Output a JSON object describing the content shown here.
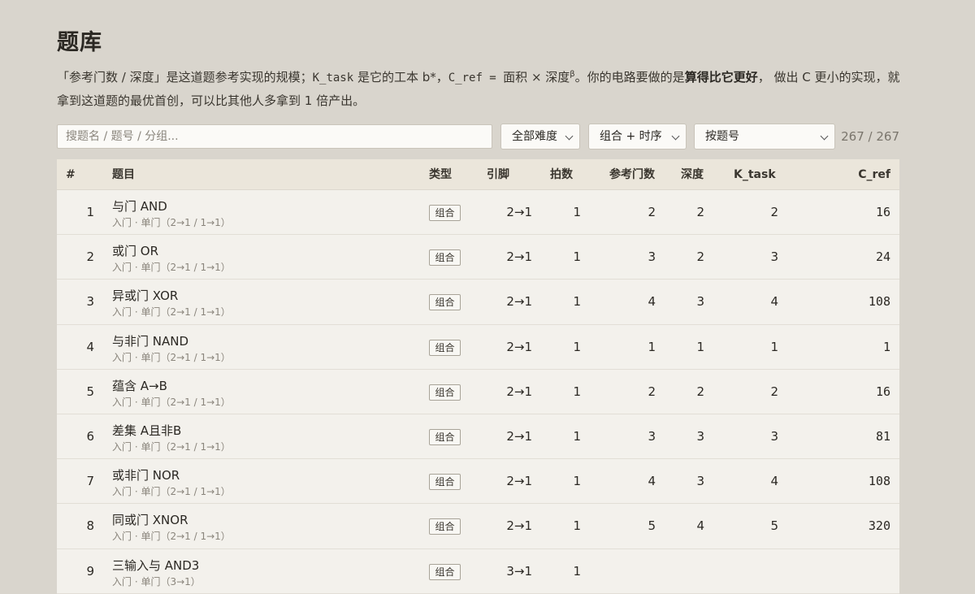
{
  "page": {
    "title": "题库",
    "intro": {
      "p1": "「参考门数 / 深度」是这道题参考实现的规模；",
      "ktask": "K_task",
      "p2": " 是它的工本 b*，",
      "cref": "C_ref = ",
      "p3": "面积 × 深度",
      "beta": "β",
      "p4": "。你的电路要做的是",
      "bold": "算得比它更好",
      "p5": "， 做出 C 更小的实现，就拿到这道题的最优首创，可以比其他人多拿到 1 倍产出。"
    }
  },
  "controls": {
    "search_placeholder": "搜题名 / 题号 / 分组...",
    "difficulty": "全部难度",
    "kind": "组合 + 时序",
    "sort": "按题号",
    "count": "267 / 267"
  },
  "table": {
    "headers": {
      "num": "#",
      "name": "题目",
      "type": "类型",
      "pins": "引脚",
      "beats": "拍数",
      "gates": "参考门数",
      "depth": "深度",
      "ktask": "K_task",
      "cref": "C_ref"
    },
    "rows": [
      {
        "num": "1",
        "name": "与门 AND",
        "sub": "入门 · 单门（2→1 / 1→1）",
        "type": "组合",
        "pins": "2→1",
        "beats": "1",
        "gates": "2",
        "depth": "2",
        "ktask": "2",
        "cref": "16"
      },
      {
        "num": "2",
        "name": "或门 OR",
        "sub": "入门 · 单门（2→1 / 1→1）",
        "type": "组合",
        "pins": "2→1",
        "beats": "1",
        "gates": "3",
        "depth": "2",
        "ktask": "3",
        "cref": "24"
      },
      {
        "num": "3",
        "name": "异或门 XOR",
        "sub": "入门 · 单门（2→1 / 1→1）",
        "type": "组合",
        "pins": "2→1",
        "beats": "1",
        "gates": "4",
        "depth": "3",
        "ktask": "4",
        "cref": "108"
      },
      {
        "num": "4",
        "name": "与非门 NAND",
        "sub": "入门 · 单门（2→1 / 1→1）",
        "type": "组合",
        "pins": "2→1",
        "beats": "1",
        "gates": "1",
        "depth": "1",
        "ktask": "1",
        "cref": "1"
      },
      {
        "num": "5",
        "name": "蕴含 A→B",
        "sub": "入门 · 单门（2→1 / 1→1）",
        "type": "组合",
        "pins": "2→1",
        "beats": "1",
        "gates": "2",
        "depth": "2",
        "ktask": "2",
        "cref": "16"
      },
      {
        "num": "6",
        "name": "差集 A且非B",
        "sub": "入门 · 单门（2→1 / 1→1）",
        "type": "组合",
        "pins": "2→1",
        "beats": "1",
        "gates": "3",
        "depth": "3",
        "ktask": "3",
        "cref": "81"
      },
      {
        "num": "7",
        "name": "或非门 NOR",
        "sub": "入门 · 单门（2→1 / 1→1）",
        "type": "组合",
        "pins": "2→1",
        "beats": "1",
        "gates": "4",
        "depth": "3",
        "ktask": "4",
        "cref": "108"
      },
      {
        "num": "8",
        "name": "同或门 XNOR",
        "sub": "入门 · 单门（2→1 / 1→1）",
        "type": "组合",
        "pins": "2→1",
        "beats": "1",
        "gates": "5",
        "depth": "4",
        "ktask": "5",
        "cref": "320"
      },
      {
        "num": "9",
        "name": "三输入与 AND3",
        "sub": "入门 · 单门（3→1）",
        "type": "组合",
        "pins": "3→1",
        "beats": "1",
        "gates": "",
        "depth": "",
        "ktask": "",
        "cref": ""
      }
    ]
  }
}
